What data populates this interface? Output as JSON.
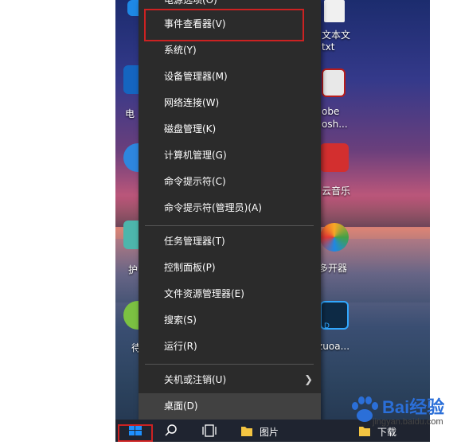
{
  "menu": {
    "partial_top_item": "电源选项(O)",
    "items": [
      {
        "label": "事件查看器(V)"
      },
      {
        "label": "系统(Y)"
      },
      {
        "label": "设备管理器(M)"
      },
      {
        "label": "网络连接(W)"
      },
      {
        "label": "磁盘管理(K)"
      },
      {
        "label": "计算机管理(G)"
      },
      {
        "label": "命令提示符(C)"
      },
      {
        "label": "命令提示符(管理员)(A)"
      },
      {
        "label": "任务管理器(T)"
      },
      {
        "label": "控制面板(P)"
      },
      {
        "label": "文件资源管理器(E)"
      },
      {
        "label": "搜索(S)"
      },
      {
        "label": "运行(R)"
      },
      {
        "label": "关机或注销(U)"
      },
      {
        "label": "桌面(D)"
      }
    ],
    "selected_item": "桌面(D)",
    "highlighted_item": "事件查看器(V)"
  },
  "desktop": {
    "left_labels": [
      "电",
      "护",
      "待"
    ],
    "right_labels": [
      "文本文",
      "txt",
      "obe",
      "osh...",
      "云音乐",
      "多开器",
      "D",
      "zuoa..."
    ]
  },
  "taskbar": {
    "pinned": [
      {
        "label": "图片"
      },
      {
        "label": "下载"
      }
    ]
  },
  "watermark": {
    "brand": "Bai经验",
    "url": "jingyan.baidu.com"
  },
  "colors": {
    "menu_bg": "#2b2b2b",
    "menu_selected_bg": "#414141",
    "highlight_border": "#cc2222",
    "start_icon": "#1e90ff"
  }
}
